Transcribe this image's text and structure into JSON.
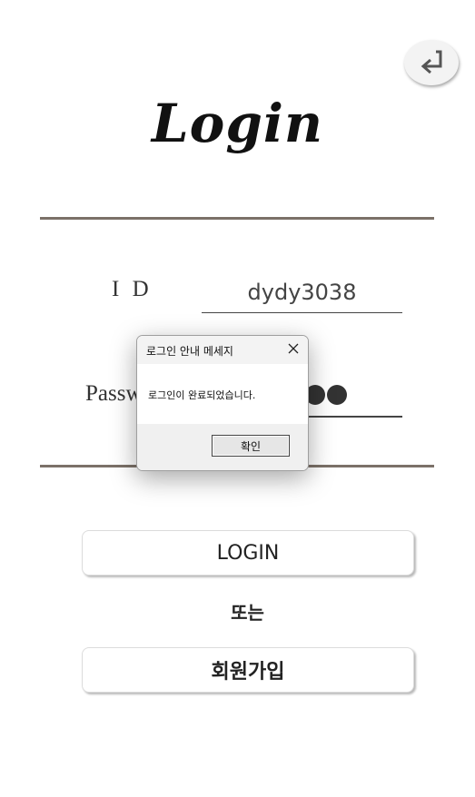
{
  "header": {
    "title": "Login"
  },
  "form": {
    "id_label": "I D",
    "id_value": "dydy3038",
    "password_label": "Password",
    "password_dot_count": 6
  },
  "actions": {
    "login_label": "LOGIN",
    "or_text": "또는",
    "signup_label": "회원가입"
  },
  "dialog": {
    "title": "로그인 안내 메세지",
    "message": "로그인이 완료되었습니다.",
    "ok_label": "확인"
  },
  "icons": {
    "back": "return-arrow-icon",
    "dialog_close": "close-icon"
  },
  "colors": {
    "rule": "#7b7168",
    "text": "#222222",
    "dialog_titlebar": "#f3f3f3",
    "dialog_footer": "#f0f0f0"
  }
}
